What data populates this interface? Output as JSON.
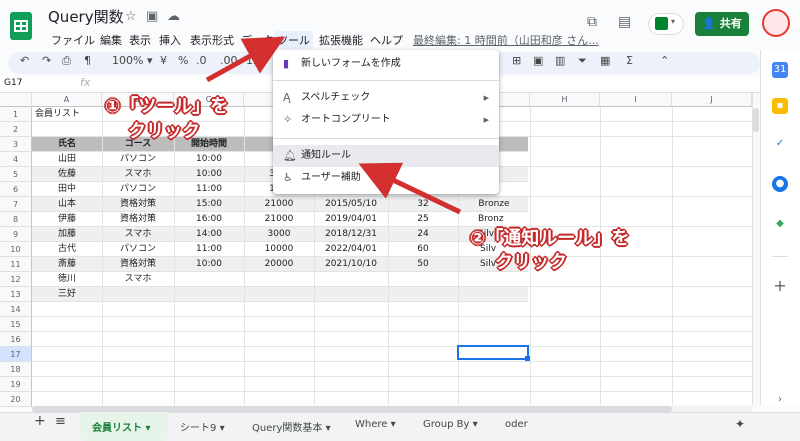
{
  "app": {
    "doc_title": "Query関数",
    "last_edit": "最終編集: 1 時間前（山田和彦 さん...",
    "share_label": "共有"
  },
  "menu": {
    "file": "ファイル",
    "edit": "編集",
    "view": "表示",
    "insert": "挿入",
    "format": "表示形式",
    "data": "データ",
    "tools": "ツール",
    "extensions": "拡張機能",
    "help": "ヘルプ"
  },
  "toolbar": {
    "zoom": "100%",
    "decimal_decrease": ".0",
    "decimal_increase": ".00",
    "number_format": "123"
  },
  "formula_bar": {
    "cell_ref": "G17",
    "fx": "fx"
  },
  "columns": [
    "A",
    "B",
    "C",
    "D",
    "E",
    "F",
    "G",
    "H",
    "I",
    "J"
  ],
  "rows": [
    "1",
    "2",
    "3",
    "4",
    "5",
    "6",
    "7",
    "8",
    "9",
    "10",
    "11",
    "12",
    "13",
    "14",
    "15",
    "16",
    "17",
    "18",
    "19",
    "20"
  ],
  "cells": {
    "a1": "会員リスト",
    "header": [
      "氏名",
      "コース",
      "開始時間",
      "料",
      "",
      "ク"
    ],
    "r4": [
      "山田",
      "パソコン",
      "10:00",
      "",
      "",
      "er"
    ],
    "r5": [
      "佐藤",
      "スマホ",
      "10:00",
      "3",
      "",
      "d"
    ],
    "r6": [
      "田中",
      "パソコン",
      "11:00",
      "1",
      "",
      "r"
    ],
    "r7": [
      "山本",
      "資格対策",
      "15:00",
      "21000",
      "2015/05/10",
      "32",
      "Bronze"
    ],
    "r8": [
      "伊藤",
      "資格対策",
      "16:00",
      "21000",
      "2019/04/01",
      "25",
      "Bronz"
    ],
    "r9": [
      "加藤",
      "スマホ",
      "14:00",
      "3000",
      "2018/12/31",
      "24",
      "Silve"
    ],
    "r10": [
      "古代",
      "パソコン",
      "11:00",
      "10000",
      "2022/04/01",
      "60",
      "Silv"
    ],
    "r11": [
      "斎藤",
      "資格対策",
      "10:00",
      "20000",
      "2021/10/10",
      "50",
      "Silv"
    ],
    "r12": [
      "徳川",
      "スマホ"
    ],
    "r13": [
      "三好"
    ]
  },
  "dropdown": {
    "new_form": "新しいフォームを作成",
    "spellcheck": "スペルチェック",
    "autocomplete": "オートコンプリート",
    "notification_rules": "通知ルール",
    "accessibility": "ユーザー補助"
  },
  "annotations": {
    "step1_line1": "①「ツール」を",
    "step1_line2": "クリック",
    "step2_line1": "②「通知ルール」を",
    "step2_line2": "クリック",
    "color": "#d32f2f"
  },
  "tabs": {
    "add": "+",
    "list": "≡",
    "items": [
      "会員リスト",
      "シート9",
      "Query関数基本",
      "Where",
      "Group By",
      "oder"
    ]
  },
  "colors": {
    "brand_green": "#188038",
    "header_row": "#bdbdbd",
    "selection": "#1a73e8"
  }
}
